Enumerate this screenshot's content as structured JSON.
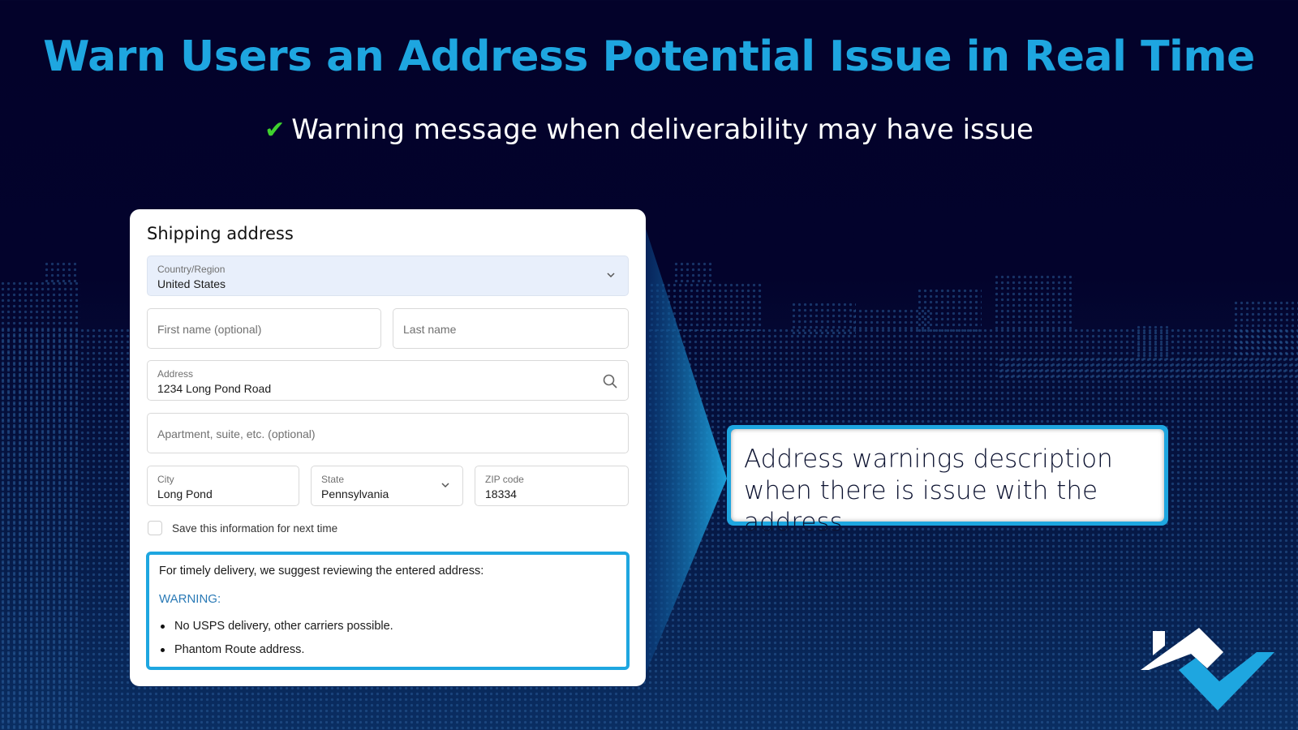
{
  "slide": {
    "headline": "Warn Users an Address Potential Issue in Real Time",
    "subline": "Warning message when deliverability may have issue",
    "subline_icon": "check-icon"
  },
  "form": {
    "title": "Shipping address",
    "country": {
      "label": "Country/Region",
      "value": "United States",
      "icon": "chevron-down-icon"
    },
    "first_name": {
      "placeholder": "First name (optional)",
      "value": ""
    },
    "last_name": {
      "placeholder": "Last name",
      "value": ""
    },
    "address": {
      "label": "Address",
      "value": "1234 Long Pond Road",
      "icon": "search-icon"
    },
    "apartment": {
      "placeholder": "Apartment, suite, etc. (optional)",
      "value": ""
    },
    "city": {
      "label": "City",
      "value": "Long Pond"
    },
    "state": {
      "label": "State",
      "value": "Pennsylvania",
      "icon": "chevron-down-icon"
    },
    "zip": {
      "label": "ZIP code",
      "value": "18334"
    },
    "save_info": {
      "label": "Save this information for next time",
      "checked": false
    },
    "warning": {
      "intro": "For timely delivery, we suggest reviewing the entered address:",
      "title": "WARNING:",
      "items": [
        "No USPS delivery, other carriers possible.",
        "Phantom Route address."
      ]
    }
  },
  "callout": {
    "text": "Address warnings description when there is issue with the address."
  },
  "colors": {
    "accent": "#1ea6e0",
    "check": "#3fd12e",
    "background_top": "#03022a",
    "background_bottom": "#0a2e62",
    "warning_title": "#2a7ab6"
  }
}
